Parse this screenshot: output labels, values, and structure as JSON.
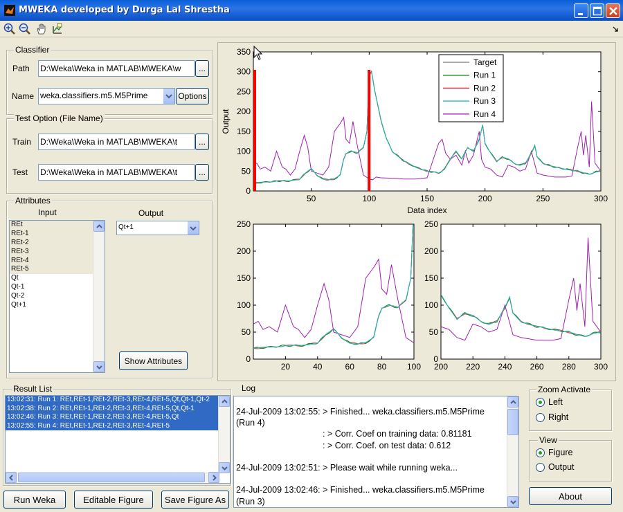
{
  "window": {
    "title": "MWEKA developed by Durga Lal Shrestha"
  },
  "toolbar": {
    "icons": [
      "zoom-in-icon",
      "zoom-out-icon",
      "pan-hand-icon",
      "data-cursor-icon"
    ]
  },
  "classifier": {
    "legend": "Classifier",
    "path_label": "Path",
    "path_value": "D:\\Weka\\Weka in MATLAB\\MWEKA\\w",
    "browse_label": "...",
    "name_label": "Name",
    "name_value": "weka.classifiers.m5.M5Prime",
    "options_label": "Options"
  },
  "test_option": {
    "legend": "Test Option (File Name)",
    "train_label": "Train",
    "train_value": "D:\\Weka\\Weka in MATLAB\\MWEKA\\t",
    "test_label": "Test",
    "test_value": "D:\\Weka\\Weka in MATLAB\\MWEKA\\t",
    "browse_label": "..."
  },
  "attributes": {
    "legend": "Attributes",
    "input_label": "Input",
    "output_label": "Output",
    "inputs": [
      "REt",
      "REt-1",
      "REt-2",
      "REt-3",
      "REt-4",
      "REt-5",
      "Qt",
      "Qt-1",
      "Qt-2",
      "Qt+1"
    ],
    "output_selected": "Qt+1",
    "show_button": "Show Attributes"
  },
  "result_list": {
    "legend": "Result List",
    "items": [
      "13:02:31: Run  1: REt,REt-1,REt-2,REt-3,REt-4,REt-5,Qt,Qt-1,Qt-2",
      "13:02:38: Run  2: REt,REt-1,REt-2,REt-3,REt-4,REt-5,Qt,Qt-1",
      "13:02:46: Run  3: REt,REt-1,REt-2,REt-3,REt-4,REt-5,Qt",
      "13:02:55: Run  4: REt,REt-1,REt-2,REt-3,REt-4,REt-5"
    ]
  },
  "log": {
    "legend": "Log",
    "lines": [
      "24-Jul-2009 13:02:55: > Finished... weka.classifiers.m5.M5Prime",
      "(Run 4)",
      "                                    : > Corr. Coef on training data: 0.81181",
      "                                    : > Corr. Coef. on test data: 0.612",
      "",
      "24-Jul-2009 13:02:51: > Please wait while running weka...",
      "",
      "24-Jul-2009 13:02:46: > Finished... weka.classifiers.m5.M5Prime",
      "(Run 3)"
    ]
  },
  "buttons": {
    "run": "Run Weka",
    "editable": "Editable Figure",
    "save": "Save Figure As",
    "about": "About"
  },
  "zoom": {
    "legend": "Zoom Activate",
    "left": "Left",
    "right": "Right",
    "selected": "Left"
  },
  "view": {
    "legend": "View",
    "figure": "Figure",
    "output": "Output",
    "selected": "Figure"
  },
  "colors": {
    "target": "#909090",
    "run1": "#1a7a1a",
    "run2": "#e03030",
    "run3": "#20b8c0",
    "run4": "#a020b0",
    "marker": "#ff0000"
  },
  "chart_data": [
    {
      "type": "line",
      "xlabel": "Data index",
      "ylabel": "Output",
      "xlim": [
        0,
        300
      ],
      "ylim": [
        0,
        350
      ],
      "xticks": [
        50,
        100,
        150,
        200,
        250,
        300
      ],
      "yticks": [
        0,
        50,
        100,
        150,
        200,
        250,
        300,
        350
      ],
      "legend_position": "top-right",
      "markers_x": [
        0,
        99
      ],
      "series": [
        {
          "name": "Target",
          "color_key": "target"
        },
        {
          "name": "Run 1",
          "color_key": "run1"
        },
        {
          "name": "Run 2",
          "color_key": "run2"
        },
        {
          "name": "Run 3",
          "color_key": "run3"
        },
        {
          "name": "Run 4",
          "color_key": "run4"
        }
      ],
      "base_x": [
        0,
        10,
        20,
        30,
        40,
        45,
        50,
        55,
        60,
        65,
        70,
        75,
        78,
        80,
        85,
        90,
        95,
        98,
        100,
        102,
        105,
        110,
        115,
        120,
        130,
        140,
        150,
        160,
        165,
        170,
        175,
        180,
        185,
        190,
        195,
        198,
        200,
        205,
        210,
        215,
        220,
        225,
        230,
        235,
        240,
        243,
        245,
        250,
        260,
        270,
        280,
        285,
        290,
        295,
        300
      ],
      "base_y": [
        20,
        22,
        25,
        25,
        30,
        45,
        55,
        40,
        30,
        28,
        30,
        40,
        80,
        95,
        100,
        95,
        110,
        150,
        290,
        300,
        250,
        180,
        130,
        100,
        75,
        60,
        50,
        45,
        55,
        80,
        100,
        80,
        110,
        100,
        130,
        165,
        120,
        95,
        75,
        85,
        80,
        70,
        65,
        70,
        95,
        115,
        85,
        70,
        60,
        55,
        50,
        45,
        42,
        48,
        50
      ],
      "run4_x": [
        0,
        3,
        6,
        10,
        15,
        20,
        25,
        28,
        32,
        36,
        40,
        44,
        47,
        50,
        55,
        60,
        65,
        70,
        75,
        78,
        80,
        83,
        86,
        90,
        95,
        100,
        103,
        106,
        110,
        120,
        130,
        140,
        150,
        160,
        163,
        166,
        170,
        175,
        180,
        183,
        186,
        190,
        195,
        197,
        200,
        205,
        210,
        215,
        220,
        225,
        230,
        235,
        240,
        245,
        250,
        260,
        270,
        275,
        280,
        283,
        285,
        287,
        290,
        292,
        295,
        300
      ],
      "run4_y": [
        65,
        70,
        55,
        60,
        50,
        100,
        60,
        55,
        40,
        55,
        100,
        140,
        110,
        50,
        45,
        40,
        60,
        150,
        170,
        185,
        130,
        120,
        175,
        110,
        40,
        30,
        28,
        35,
        33,
        32,
        30,
        30,
        33,
        120,
        130,
        95,
        80,
        90,
        65,
        100,
        70,
        90,
        150,
        80,
        60,
        55,
        40,
        35,
        65,
        60,
        50,
        55,
        100,
        45,
        40,
        35,
        35,
        38,
        110,
        150,
        90,
        140,
        60,
        225,
        70,
        50
      ]
    },
    {
      "type": "line",
      "xlim": [
        0,
        100
      ],
      "ylim": [
        0,
        250
      ],
      "xticks": [
        20,
        40,
        60,
        80,
        100
      ],
      "yticks": [
        0,
        50,
        100,
        150,
        200,
        250
      ],
      "source_range": [
        0,
        100
      ]
    },
    {
      "type": "line",
      "xlim": [
        200,
        300
      ],
      "ylim": [
        0,
        250
      ],
      "xticks": [
        200,
        220,
        240,
        260,
        280,
        300
      ],
      "yticks": [
        0,
        50,
        100,
        150,
        200,
        250
      ],
      "source_range": [
        200,
        300
      ]
    }
  ]
}
